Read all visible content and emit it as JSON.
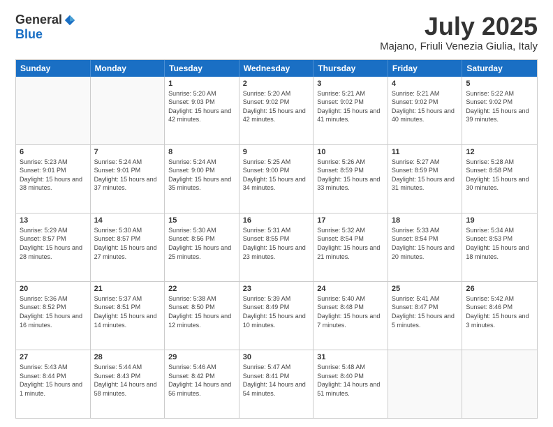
{
  "logo": {
    "general": "General",
    "blue": "Blue"
  },
  "title": "July 2025",
  "location": "Majano, Friuli Venezia Giulia, Italy",
  "days": [
    "Sunday",
    "Monday",
    "Tuesday",
    "Wednesday",
    "Thursday",
    "Friday",
    "Saturday"
  ],
  "weeks": [
    [
      {
        "day": "",
        "info": ""
      },
      {
        "day": "",
        "info": ""
      },
      {
        "day": "1",
        "info": "Sunrise: 5:20 AM\nSunset: 9:03 PM\nDaylight: 15 hours and 42 minutes."
      },
      {
        "day": "2",
        "info": "Sunrise: 5:20 AM\nSunset: 9:02 PM\nDaylight: 15 hours and 42 minutes."
      },
      {
        "day": "3",
        "info": "Sunrise: 5:21 AM\nSunset: 9:02 PM\nDaylight: 15 hours and 41 minutes."
      },
      {
        "day": "4",
        "info": "Sunrise: 5:21 AM\nSunset: 9:02 PM\nDaylight: 15 hours and 40 minutes."
      },
      {
        "day": "5",
        "info": "Sunrise: 5:22 AM\nSunset: 9:02 PM\nDaylight: 15 hours and 39 minutes."
      }
    ],
    [
      {
        "day": "6",
        "info": "Sunrise: 5:23 AM\nSunset: 9:01 PM\nDaylight: 15 hours and 38 minutes."
      },
      {
        "day": "7",
        "info": "Sunrise: 5:24 AM\nSunset: 9:01 PM\nDaylight: 15 hours and 37 minutes."
      },
      {
        "day": "8",
        "info": "Sunrise: 5:24 AM\nSunset: 9:00 PM\nDaylight: 15 hours and 35 minutes."
      },
      {
        "day": "9",
        "info": "Sunrise: 5:25 AM\nSunset: 9:00 PM\nDaylight: 15 hours and 34 minutes."
      },
      {
        "day": "10",
        "info": "Sunrise: 5:26 AM\nSunset: 8:59 PM\nDaylight: 15 hours and 33 minutes."
      },
      {
        "day": "11",
        "info": "Sunrise: 5:27 AM\nSunset: 8:59 PM\nDaylight: 15 hours and 31 minutes."
      },
      {
        "day": "12",
        "info": "Sunrise: 5:28 AM\nSunset: 8:58 PM\nDaylight: 15 hours and 30 minutes."
      }
    ],
    [
      {
        "day": "13",
        "info": "Sunrise: 5:29 AM\nSunset: 8:57 PM\nDaylight: 15 hours and 28 minutes."
      },
      {
        "day": "14",
        "info": "Sunrise: 5:30 AM\nSunset: 8:57 PM\nDaylight: 15 hours and 27 minutes."
      },
      {
        "day": "15",
        "info": "Sunrise: 5:30 AM\nSunset: 8:56 PM\nDaylight: 15 hours and 25 minutes."
      },
      {
        "day": "16",
        "info": "Sunrise: 5:31 AM\nSunset: 8:55 PM\nDaylight: 15 hours and 23 minutes."
      },
      {
        "day": "17",
        "info": "Sunrise: 5:32 AM\nSunset: 8:54 PM\nDaylight: 15 hours and 21 minutes."
      },
      {
        "day": "18",
        "info": "Sunrise: 5:33 AM\nSunset: 8:54 PM\nDaylight: 15 hours and 20 minutes."
      },
      {
        "day": "19",
        "info": "Sunrise: 5:34 AM\nSunset: 8:53 PM\nDaylight: 15 hours and 18 minutes."
      }
    ],
    [
      {
        "day": "20",
        "info": "Sunrise: 5:36 AM\nSunset: 8:52 PM\nDaylight: 15 hours and 16 minutes."
      },
      {
        "day": "21",
        "info": "Sunrise: 5:37 AM\nSunset: 8:51 PM\nDaylight: 15 hours and 14 minutes."
      },
      {
        "day": "22",
        "info": "Sunrise: 5:38 AM\nSunset: 8:50 PM\nDaylight: 15 hours and 12 minutes."
      },
      {
        "day": "23",
        "info": "Sunrise: 5:39 AM\nSunset: 8:49 PM\nDaylight: 15 hours and 10 minutes."
      },
      {
        "day": "24",
        "info": "Sunrise: 5:40 AM\nSunset: 8:48 PM\nDaylight: 15 hours and 7 minutes."
      },
      {
        "day": "25",
        "info": "Sunrise: 5:41 AM\nSunset: 8:47 PM\nDaylight: 15 hours and 5 minutes."
      },
      {
        "day": "26",
        "info": "Sunrise: 5:42 AM\nSunset: 8:46 PM\nDaylight: 15 hours and 3 minutes."
      }
    ],
    [
      {
        "day": "27",
        "info": "Sunrise: 5:43 AM\nSunset: 8:44 PM\nDaylight: 15 hours and 1 minute."
      },
      {
        "day": "28",
        "info": "Sunrise: 5:44 AM\nSunset: 8:43 PM\nDaylight: 14 hours and 58 minutes."
      },
      {
        "day": "29",
        "info": "Sunrise: 5:46 AM\nSunset: 8:42 PM\nDaylight: 14 hours and 56 minutes."
      },
      {
        "day": "30",
        "info": "Sunrise: 5:47 AM\nSunset: 8:41 PM\nDaylight: 14 hours and 54 minutes."
      },
      {
        "day": "31",
        "info": "Sunrise: 5:48 AM\nSunset: 8:40 PM\nDaylight: 14 hours and 51 minutes."
      },
      {
        "day": "",
        "info": ""
      },
      {
        "day": "",
        "info": ""
      }
    ]
  ]
}
